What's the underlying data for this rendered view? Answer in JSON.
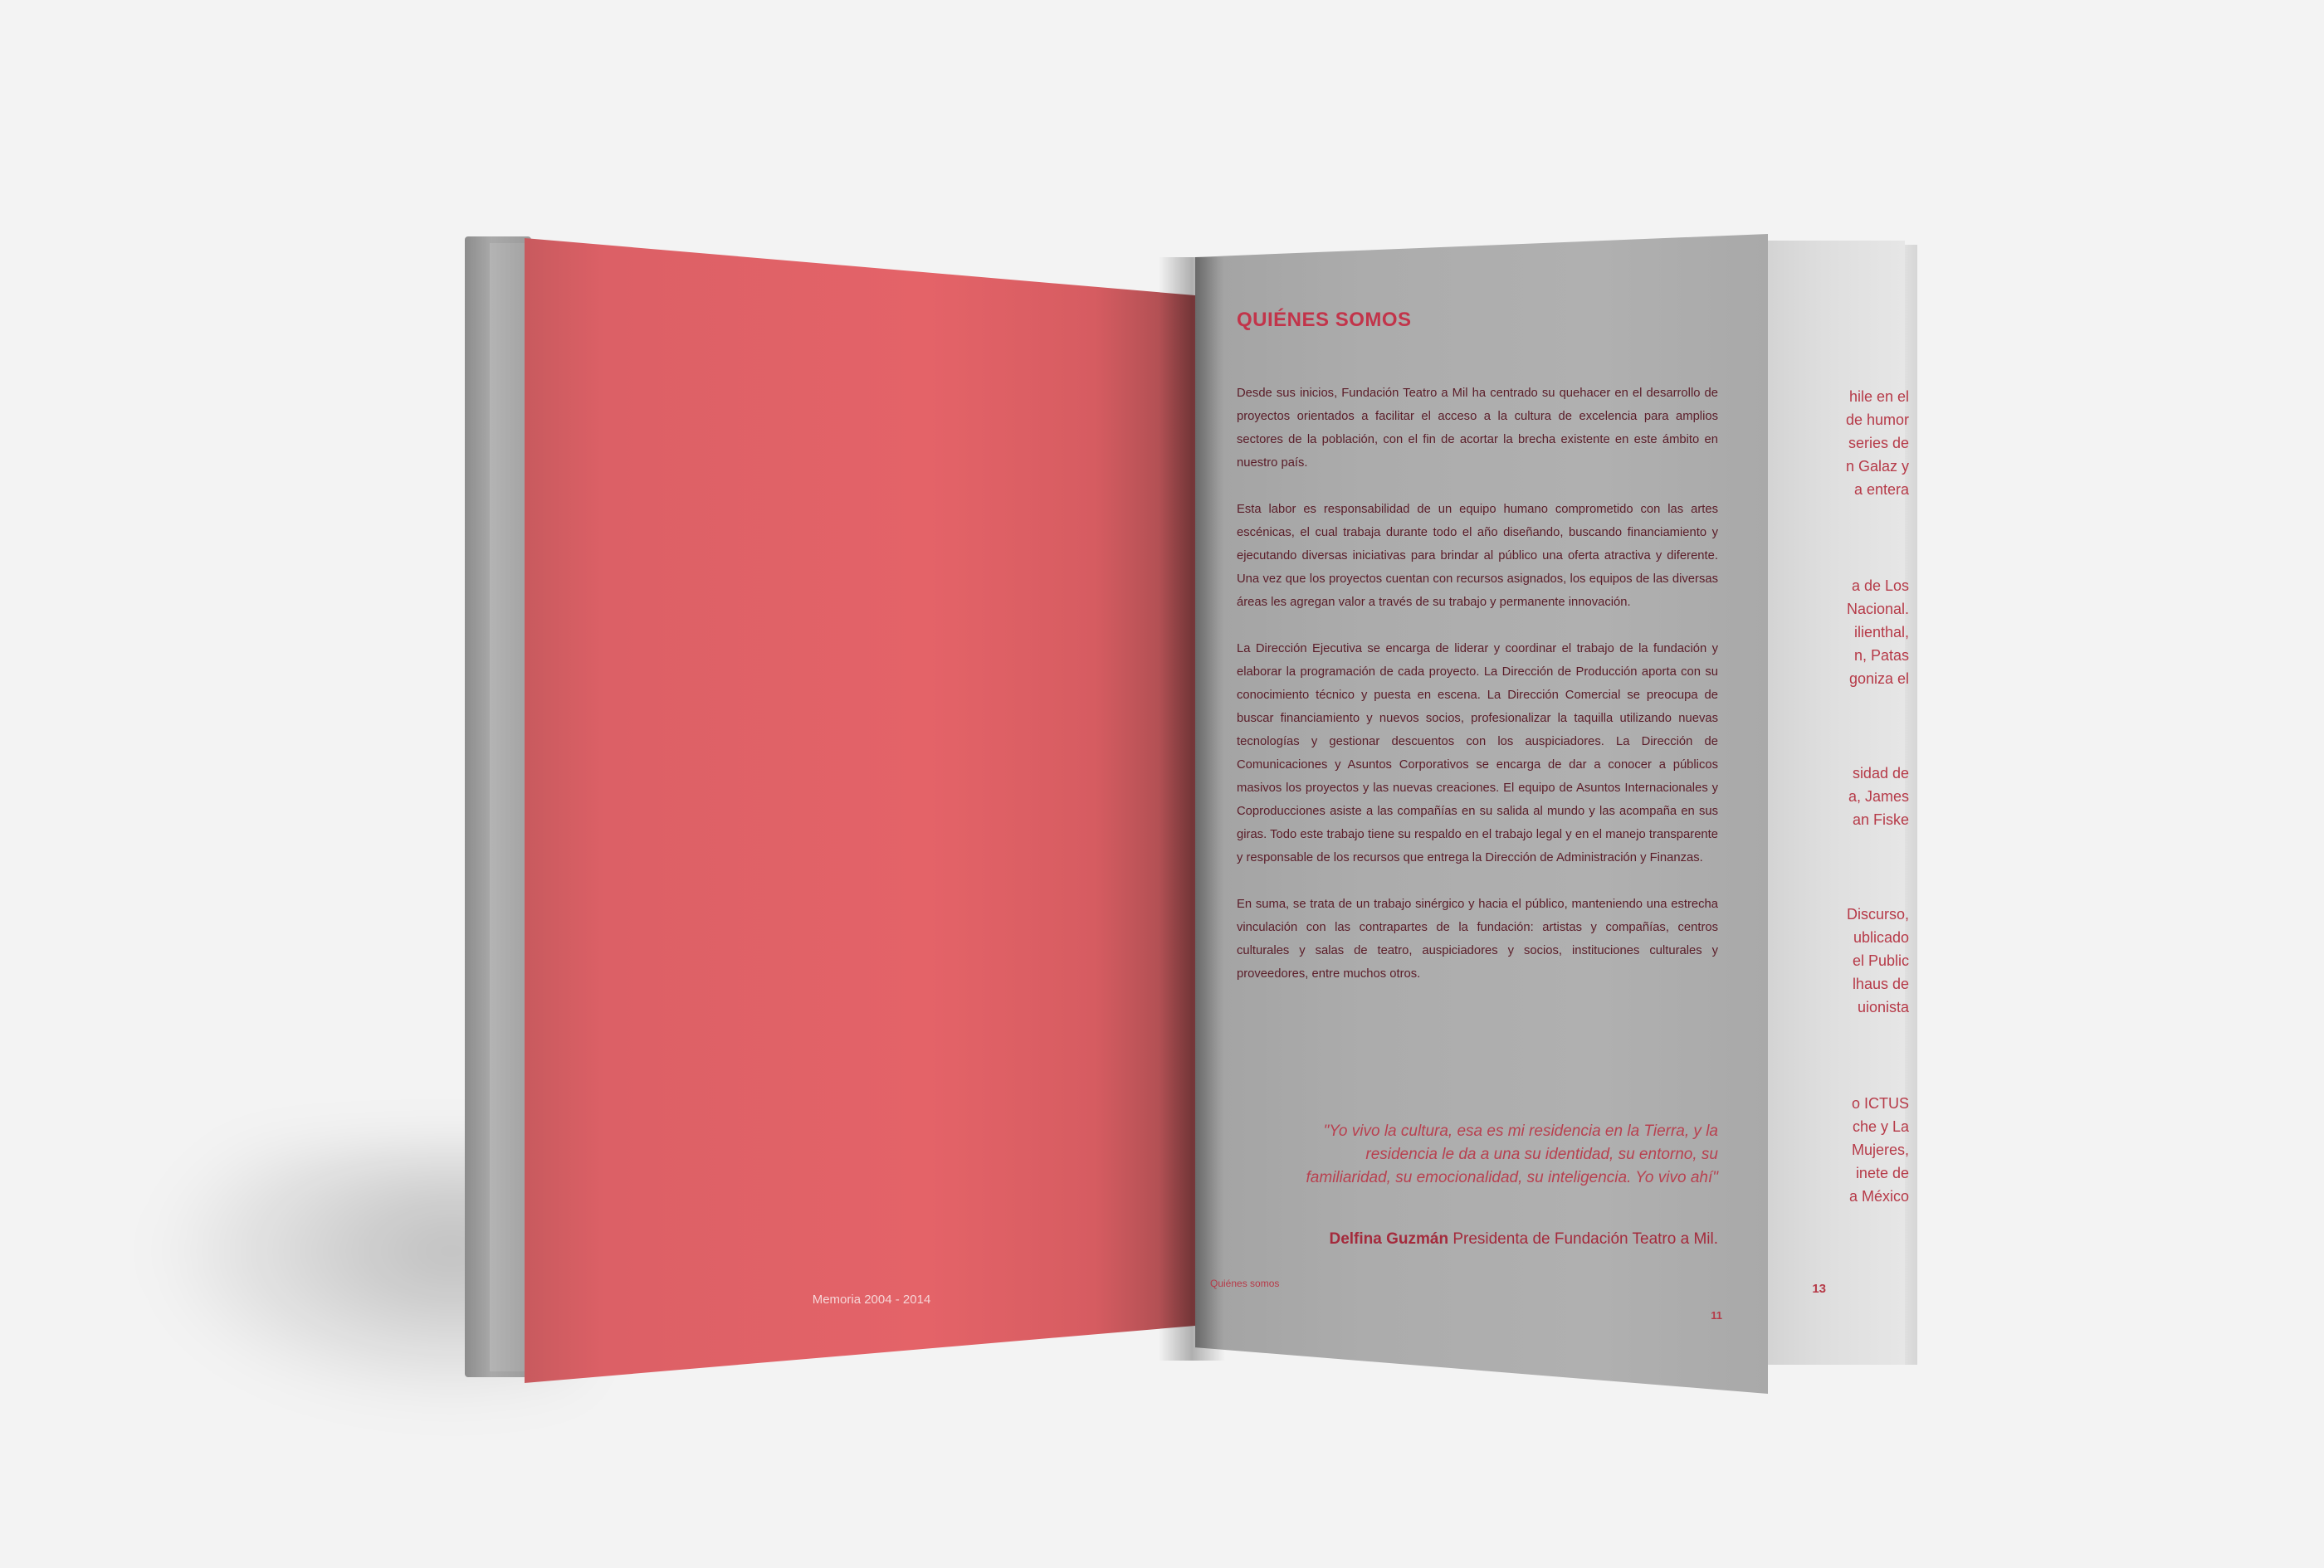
{
  "left_page": {
    "footer": "Memoria 2004 - 2014"
  },
  "right_page": {
    "title": "QUIÉNES SOMOS",
    "paragraphs": [
      "Desde sus inicios, Fundación Teatro a Mil ha centrado su quehacer en el desarrollo de proyectos orientados a facilitar el acceso a la cultura de excelencia para amplios sectores de la población, con el fin de acortar la brecha existente en este ámbito en nuestro país.",
      "Esta labor es responsabilidad de un equipo humano comprometido con las artes escénicas, el cual trabaja durante todo el año diseñando, buscando financiamiento y ejecutando diversas iniciativas para brindar al público una oferta atractiva y diferente. Una vez que los proyectos cuentan con recursos asignados, los equipos de las diversas áreas les agregan valor a través de su trabajo y permanente innovación.",
      "La Dirección Ejecutiva se encarga de liderar y coordinar el trabajo de la fundación y elaborar la programación de cada proyecto. La Dirección de Producción aporta con su conocimiento técnico y puesta en escena. La Dirección Comercial se preocupa de buscar financiamiento y nuevos socios, profesionalizar la taquilla utilizando nuevas tecnologías y gestionar descuentos con los auspiciadores. La Dirección de Comunicaciones y Asuntos Corporativos se encarga de dar a conocer a públicos masivos los proyectos y las nuevas creaciones. El equipo de Asuntos Internacionales y Coproducciones asiste a las compañías en su salida al mundo y las acompaña en sus giras. Todo este trabajo tiene su respaldo en el trabajo legal y en el manejo transparente y responsable de los recursos que entrega la Dirección de Administración y Finanzas.",
      "En suma, se trata de un trabajo sinérgico y hacia el público, manteniendo una estrecha vinculación con las contrapartes de la fundación: artistas y compañías, centros culturales y salas de teatro, auspiciadores y socios, instituciones culturales y proveedores, entre muchos otros."
    ],
    "quote": "\"Yo vivo la cultura, esa es mi residencia en la Tierra, y la residencia le da a una su identidad, su entorno, su familiaridad, su emocionalidad, su inteligencia. Yo vivo ahí\"",
    "signature_name": "Delfina Guzmán",
    "signature_role": " Presidenta de Fundación Teatro a Mil.",
    "footer_label": "Quiénes somos",
    "page_number": "11"
  },
  "behind_page": {
    "block1": [
      "hile en el",
      "de humor",
      "series de",
      "n Galaz y",
      "a entera"
    ],
    "block2": [
      "a de Los",
      "Nacional.",
      "ilienthal,",
      "n, Patas",
      "goniza el"
    ],
    "block3": [
      "sidad de",
      "a, James",
      "an Fiske"
    ],
    "block4": [
      "Discurso,",
      "ublicado",
      "el Public",
      "lhaus de",
      "uionista"
    ],
    "block5": [
      "o   ICTUS",
      "che y La",
      "Mujeres,",
      "inete de",
      "a México"
    ],
    "page_number": "13"
  }
}
